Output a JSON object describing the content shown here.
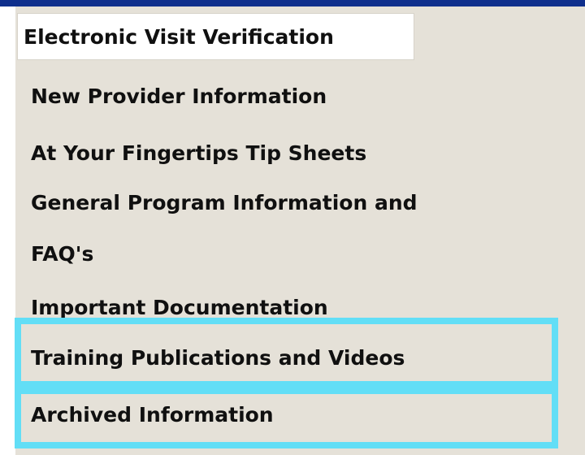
{
  "menu": {
    "header": "Electronic Visit Verification",
    "items": [
      {
        "label": "New Provider Information"
      },
      {
        "label": "At Your Fingertips Tip Sheets"
      },
      {
        "label": "General Program Information and"
      },
      {
        "label": "FAQ's"
      },
      {
        "label": "Important Documentation"
      },
      {
        "label": "Training Publications and Videos"
      },
      {
        "label": "Archived Information"
      }
    ]
  },
  "colors": {
    "top_border": "#0f2f8c",
    "panel_background": "#e5e1d8",
    "header_background": "#ffffff",
    "highlight": "#62def6",
    "text": "#101010"
  }
}
